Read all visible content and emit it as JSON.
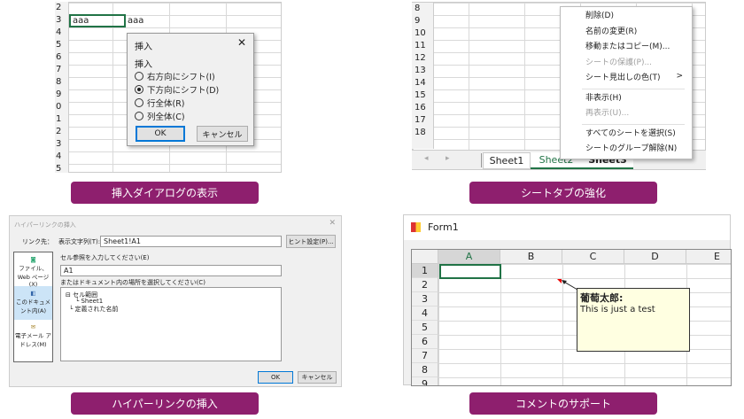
{
  "panel1": {
    "row_labels": [
      "2",
      "3",
      "4",
      "5",
      "6",
      "7",
      "8",
      "9",
      "0",
      "1",
      "2",
      "3",
      "4",
      "5"
    ],
    "cell_a3": "aaa",
    "cell_b3": "aaa",
    "dialog": {
      "title": "挿入",
      "group_label": "挿入",
      "options": [
        {
          "label": "右方向にシフト(I)",
          "selected": false
        },
        {
          "label": "下方向にシフト(D)",
          "selected": true
        },
        {
          "label": "行全体(R)",
          "selected": false
        },
        {
          "label": "列全体(C)",
          "selected": false
        }
      ],
      "ok": "OK",
      "cancel": "キャンセル"
    },
    "caption": "挿入ダイアログの表示"
  },
  "panel2": {
    "row_labels": [
      "8",
      "9",
      "10",
      "11",
      "12",
      "13",
      "14",
      "15",
      "16",
      "17",
      "18"
    ],
    "menu": [
      {
        "label": "削除(D)",
        "disabled": false
      },
      {
        "label": "名前の変更(R)",
        "disabled": false
      },
      {
        "label": "移動またはコピー(M)...",
        "disabled": false
      },
      {
        "label": "シートの保護(P)...",
        "disabled": true
      },
      {
        "label": "シート見出しの色(T)",
        "disabled": false,
        "submenu": ">"
      },
      {
        "label": "非表示(H)",
        "disabled": false
      },
      {
        "label": "再表示(U)...",
        "disabled": true
      },
      {
        "label": "すべてのシートを選択(S)",
        "disabled": false
      },
      {
        "label": "シートのグループ解除(N)",
        "disabled": false
      }
    ],
    "tabs": [
      "Sheet1",
      "Sheet2",
      "Sheet3"
    ],
    "accent": "#217346",
    "caption": "シートタブの強化"
  },
  "panel3": {
    "title": "ハイパーリンクの挿入",
    "link_to_label": "リンク先：",
    "display_text_label": "表示文字列(T):",
    "display_text_value": "Sheet1!A1",
    "hint_button": "ヒント設定(P)...",
    "nav": [
      "ファイル、Web ページ(X)",
      "このドキュメント内(A)",
      "電子メール アドレス(M)"
    ],
    "cell_ref_label": "セル参照を入力してください(E)",
    "cell_ref_value": "A1",
    "place_label": "またはドキュメント内の場所を選択してください(C)",
    "tree": [
      "セル範囲",
      "Sheet1",
      "定義された名前"
    ],
    "ok": "OK",
    "cancel": "キャンセル",
    "caption": "ハイパーリンクの挿入"
  },
  "panel4": {
    "window_title": "Form1",
    "columns": [
      "A",
      "B",
      "C",
      "D",
      "E"
    ],
    "rows": [
      "1",
      "2",
      "3",
      "4",
      "5",
      "6",
      "7",
      "8",
      "9"
    ],
    "comment_author": "葡萄太郎:",
    "comment_text": "This is just a test",
    "caption": "コメントのサポート"
  },
  "caption_color": "#8e1f6e"
}
